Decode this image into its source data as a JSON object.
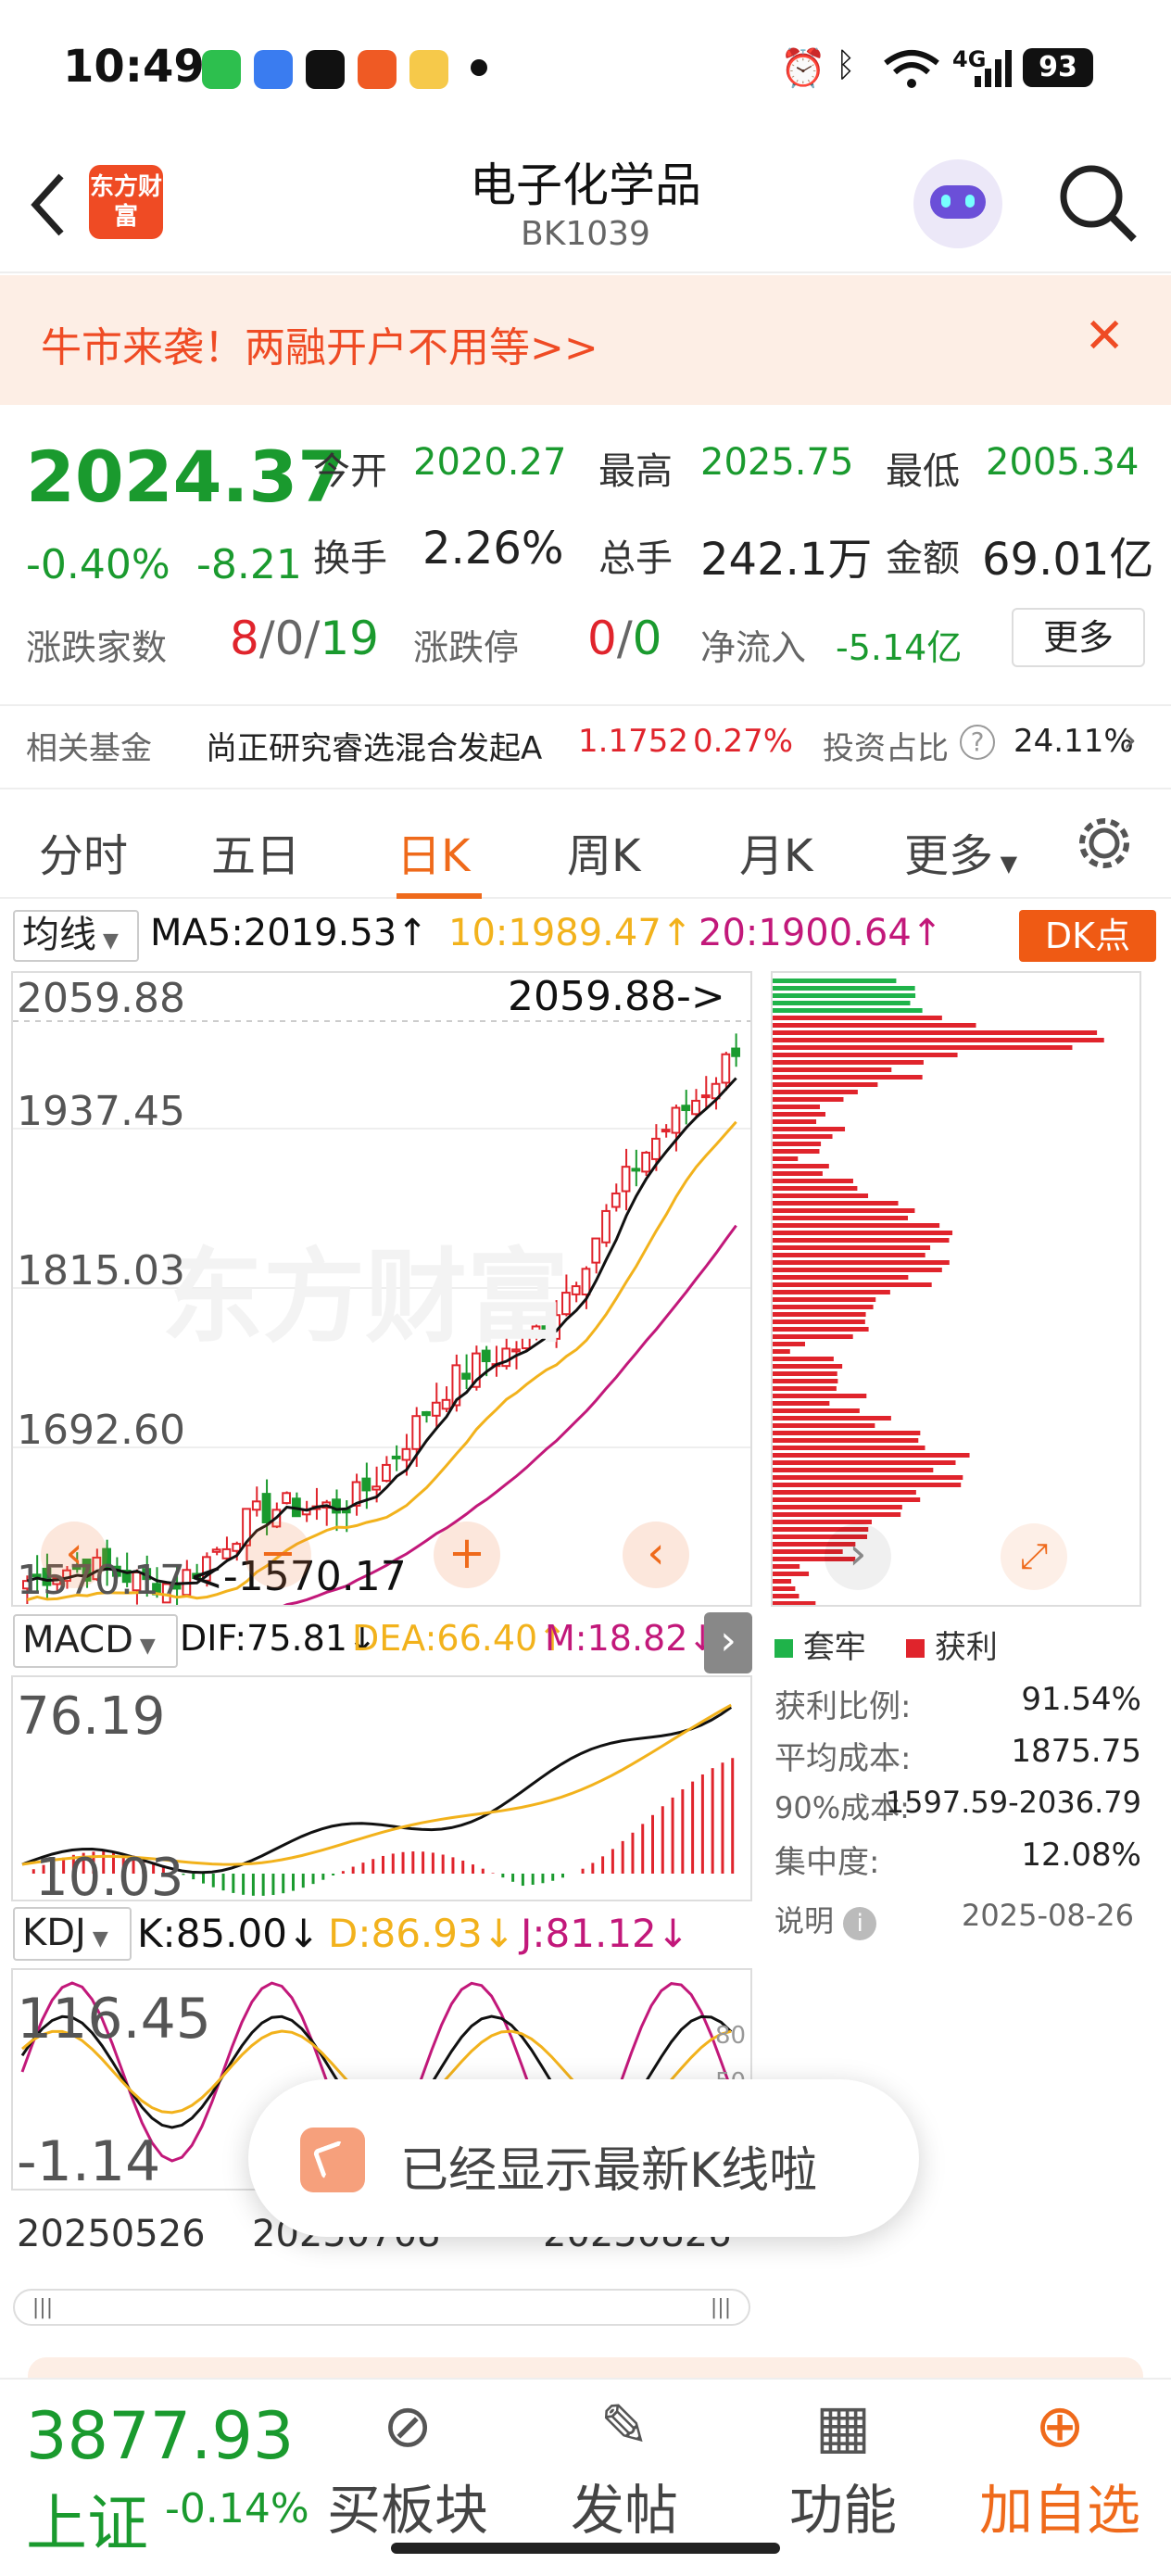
{
  "status": {
    "time": "10:49",
    "battery": "93",
    "network": "4G"
  },
  "header": {
    "title": "电子化学品",
    "code": "BK1039",
    "logo_text": "东方财富"
  },
  "banner": {
    "text": "牛市来袭！两融开户不用等>>"
  },
  "quote": {
    "price": "2024.37",
    "change_pct": "-0.40%",
    "change": "-8.21",
    "open_label": "今开",
    "open": "2020.27",
    "high_label": "最高",
    "high": "2025.75",
    "low_label": "最低",
    "low": "2005.34",
    "turnover_label": "换手",
    "turnover": "2.26%",
    "volume_label": "总手",
    "volume": "242.1万",
    "amount_label": "金额",
    "amount": "69.01亿",
    "updown_label": "涨跌家数",
    "up": "8",
    "flat": "0",
    "down": "19",
    "limit_label": "涨跌停",
    "limit_up": "0",
    "limit_down": "0",
    "inflow_label": "净流入",
    "inflow": "-5.14亿",
    "more": "更多"
  },
  "fund": {
    "label": "相关基金",
    "name": "尚正研究睿选混合发起A",
    "nav": "1.1752",
    "pct": "0.27%",
    "ratio_label": "投资占比",
    "ratio": "24.11%"
  },
  "tabs": [
    "分时",
    "五日",
    "日K",
    "周K",
    "月K",
    "更多"
  ],
  "ma": {
    "selector": "均线",
    "ma5": "MA5:2019.53",
    "ma10": "10:1989.47",
    "ma20": "20:1900.64",
    "dk": "DK点"
  },
  "kchart": {
    "y_labels": [
      "2059.88",
      "1937.45",
      "1815.03",
      "1692.60",
      "1570.17"
    ],
    "max_note": "2059.88->",
    "min_note": "<-1570.17"
  },
  "macd": {
    "selector": "MACD",
    "dif": "DIF:75.81",
    "dea": "DEA:66.40",
    "m": "M:18.82",
    "y_top": "76.19",
    "y_bottom": "10.03"
  },
  "kdj": {
    "selector": "KDJ",
    "k": "K:85.00",
    "d": "D:86.93",
    "j": "J:81.12",
    "y_top": "116.45",
    "y_bottom": "-1.14",
    "ticks": [
      "80",
      "50"
    ]
  },
  "dates": [
    "20250526",
    "20250708",
    "20250826"
  ],
  "chip": {
    "legend_loss": "套牢",
    "legend_profit": "获利",
    "rows": [
      {
        "label": "获利比例:",
        "value": "91.54%"
      },
      {
        "label": "平均成本:",
        "value": "1875.75"
      },
      {
        "label": "90%成本:",
        "value": "1597.59-2036.79"
      },
      {
        "label": "集中度:",
        "value": "12.08%"
      }
    ],
    "note": "说明",
    "date": "2025-08-26"
  },
  "toast": {
    "text": "已经显示最新K线啦"
  },
  "bottom": {
    "index_value": "3877.93",
    "index_name": "上证",
    "index_change": "-0.14%",
    "items": [
      "买板块",
      "发帖",
      "功能",
      "加自选"
    ]
  },
  "watermark": "东方财富",
  "colors": {
    "up": "#e0242c",
    "down": "#1a9a2e",
    "accent": "#ef6a1b",
    "ma5": "#111111",
    "ma10": "#f2b21c",
    "ma20": "#c2187a"
  }
}
